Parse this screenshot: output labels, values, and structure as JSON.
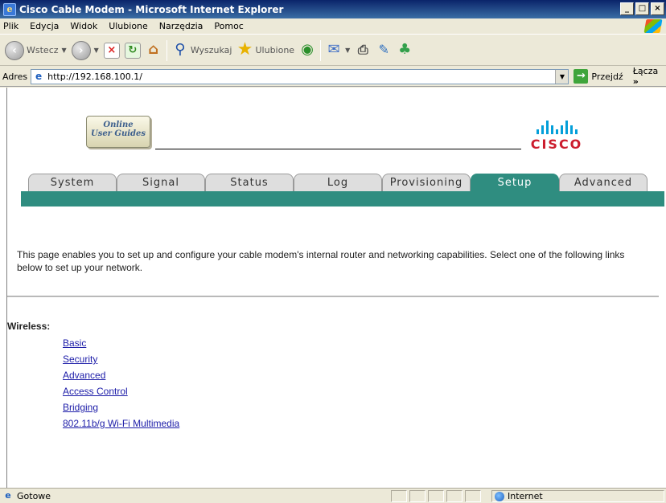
{
  "window": {
    "title": "Cisco Cable Modem - Microsoft Internet Explorer"
  },
  "menu": {
    "items": [
      "Plik",
      "Edycja",
      "Widok",
      "Ulubione",
      "Narzędzia",
      "Pomoc"
    ]
  },
  "toolbar": {
    "back_label": "Wstecz",
    "search_label": "Wyszukaj",
    "favorites_label": "Ulubione"
  },
  "address": {
    "label": "Adres",
    "url": "http://192.168.100.1/",
    "go_label": "Przejdź",
    "links_label": "Łącza"
  },
  "header": {
    "guides_logo_line1": "Online",
    "guides_logo_line2": "User Guides",
    "brand": "CISCO"
  },
  "tabs": [
    {
      "label": "System",
      "active": false
    },
    {
      "label": "Signal",
      "active": false
    },
    {
      "label": "Status",
      "active": false
    },
    {
      "label": "Log",
      "active": false
    },
    {
      "label": "Provisioning",
      "active": false
    },
    {
      "label": "Setup",
      "active": true
    },
    {
      "label": "Advanced",
      "active": false
    }
  ],
  "content": {
    "intro": "This page enables you to set up and configure your cable modem's internal router and networking capabilities.  Select one of the following links below to set up your network.",
    "section_heading": "Wireless:",
    "links": [
      "Basic",
      "Security",
      "Advanced",
      "Access Control",
      "Bridging",
      "802.11b/g Wi-Fi Multimedia"
    ]
  },
  "status": {
    "text": "Gotowe",
    "zone": "Internet"
  },
  "colors": {
    "tab_active": "#2f8d80",
    "cisco_red": "#cc1d2e",
    "cisco_blue": "#049fd9",
    "link": "#1c1ca8"
  }
}
